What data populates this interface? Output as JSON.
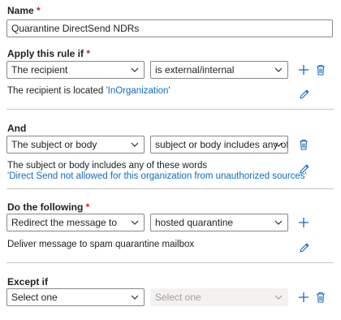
{
  "name_section": {
    "label": "Name",
    "required_mark": "*",
    "value": "Quarantine DirectSend NDRs"
  },
  "apply_section": {
    "label": "Apply this rule if",
    "required_mark": "*",
    "condition_select": "The recipient",
    "operator_select": "is external/internal",
    "description_prefix": "The recipient is located ",
    "description_value": "'InOrganization'"
  },
  "and_section": {
    "label": "And",
    "condition_select": "The subject or body",
    "operator_select": "subject or body includes any of these words",
    "description": "The subject or body includes any of these words",
    "description_value": "'Direct Send not allowed for this organization from unauthorized sources'"
  },
  "do_section": {
    "label": "Do the following",
    "required_mark": "*",
    "action_select": "Redirect the message to",
    "target_select": "hosted quarantine",
    "description": "Deliver message to spam quarantine mailbox"
  },
  "except_section": {
    "label": "Except if",
    "condition_select": "Select one",
    "operator_select": "Select one"
  },
  "icons": {
    "add": "plus-icon",
    "delete": "trash-icon",
    "edit": "pencil-icon",
    "dropdown": "chevron-down-icon"
  },
  "colors": {
    "accent": "#0f6cbd",
    "required": "#c4262e",
    "border": "#8a8886"
  }
}
